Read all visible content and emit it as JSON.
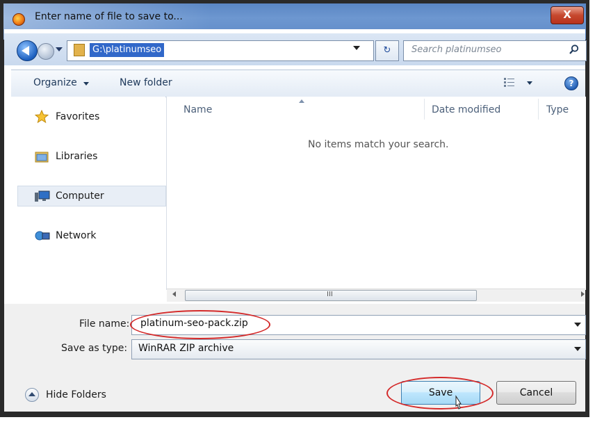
{
  "window": {
    "title": "Enter name of file to save to...",
    "close_label": "X"
  },
  "address": {
    "path": "G:\\platinumseo",
    "search_placeholder": "Search platinumseo",
    "refresh_label": "↻"
  },
  "toolbar": {
    "organize_label": "Organize",
    "new_folder_label": "New folder",
    "help_label": "?"
  },
  "nav": {
    "items": [
      {
        "label": "Favorites",
        "icon": "star-icon"
      },
      {
        "label": "Libraries",
        "icon": "libraries-icon"
      },
      {
        "label": "Computer",
        "icon": "computer-icon",
        "selected": true
      },
      {
        "label": "Network",
        "icon": "network-icon"
      }
    ]
  },
  "file_list": {
    "columns": [
      "Name",
      "Date modified",
      "Type"
    ],
    "empty_message": "No items match your search.",
    "scroll_grip": "III"
  },
  "form": {
    "file_name_label": "File name:",
    "file_name_value": "platinum-seo-pack.zip",
    "save_type_label": "Save as type:",
    "save_type_value": "WinRAR ZIP archive"
  },
  "footer": {
    "hide_folders_label": "Hide Folders",
    "save_label": "Save",
    "cancel_label": "Cancel"
  },
  "colors": {
    "annotation": "#d42a2a",
    "selection": "#3168c9",
    "title_bar": "#6d97d0"
  }
}
